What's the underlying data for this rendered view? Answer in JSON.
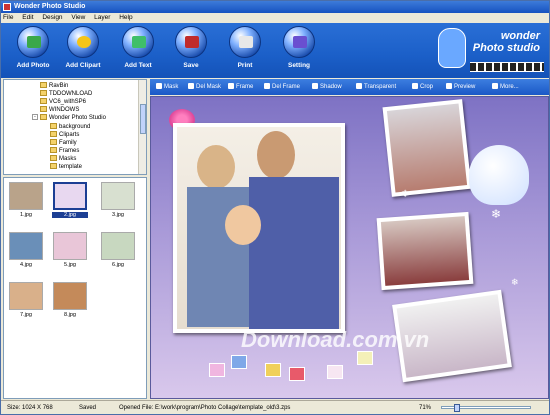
{
  "window": {
    "title": "Wonder Photo Studio"
  },
  "menu": [
    "File",
    "Edit",
    "Design",
    "View",
    "Layer",
    "Help"
  ],
  "toolbar": {
    "buttons": [
      {
        "label": "Add Photo",
        "icon": "add-photo-icon",
        "color": "#3aa84a"
      },
      {
        "label": "Add Clipart",
        "icon": "add-clipart-icon",
        "color": "#f5c518"
      },
      {
        "label": "Add Text",
        "icon": "add-text-icon",
        "color": "#3fbf6a"
      },
      {
        "label": "Save",
        "icon": "save-icon",
        "color": "#c02b2b"
      },
      {
        "label": "Print",
        "icon": "print-icon",
        "color": "#e8e8e8"
      },
      {
        "label": "Setting",
        "icon": "setting-icon",
        "color": "#6a4fd0"
      }
    ],
    "logo_line1": "wonder",
    "logo_line2": "Photo studio"
  },
  "tree": {
    "items": [
      {
        "label": "RavBin",
        "indent": 2
      },
      {
        "label": "TDDOWNLOAD",
        "indent": 2
      },
      {
        "label": "VC6_withSP6",
        "indent": 2
      },
      {
        "label": "WINDOWS",
        "indent": 2
      },
      {
        "label": "Wonder Photo Studio",
        "indent": 2,
        "expanded": true
      },
      {
        "label": "background",
        "indent": 3
      },
      {
        "label": "Cliparts",
        "indent": 3
      },
      {
        "label": "Family",
        "indent": 3
      },
      {
        "label": "Frames",
        "indent": 3
      },
      {
        "label": "Masks",
        "indent": 3
      },
      {
        "label": "template",
        "indent": 3
      }
    ]
  },
  "thumbnails": [
    {
      "label": "1.jpg",
      "selected": false,
      "color": "#b9a38a"
    },
    {
      "label": "2.jpg",
      "selected": true,
      "color": "#e8d8f0"
    },
    {
      "label": "3.jpg",
      "selected": false,
      "color": "#d8e0d0"
    },
    {
      "label": "4.jpg",
      "selected": false,
      "color": "#6a8fb8"
    },
    {
      "label": "5.jpg",
      "selected": false,
      "color": "#e9c6d8"
    },
    {
      "label": "6.jpg",
      "selected": false,
      "color": "#c8d8c0"
    },
    {
      "label": "7.jpg",
      "selected": false,
      "color": "#d9b08a"
    },
    {
      "label": "8.jpg",
      "selected": false,
      "color": "#c48a5a"
    }
  ],
  "effects_bar": [
    {
      "label": "Mask"
    },
    {
      "label": "Del Mask"
    },
    {
      "label": "Frame"
    },
    {
      "label": "Del Frame"
    },
    {
      "label": "Shadow"
    },
    {
      "label": "Transparent"
    },
    {
      "label": "Crop"
    },
    {
      "label": "Preview"
    },
    {
      "label": "More..."
    }
  ],
  "canvas": {
    "watermark": "Download.com.vn"
  },
  "status": {
    "size": "Size: 1024 X 768",
    "state": "Saved",
    "opened": "Opened File: E:\\work\\program\\Photo Collage\\template_old\\3.zps",
    "zoom": "71%"
  },
  "colors": {
    "toolbar_blue": "#1b5fc8",
    "selection": "#1c3f94"
  }
}
